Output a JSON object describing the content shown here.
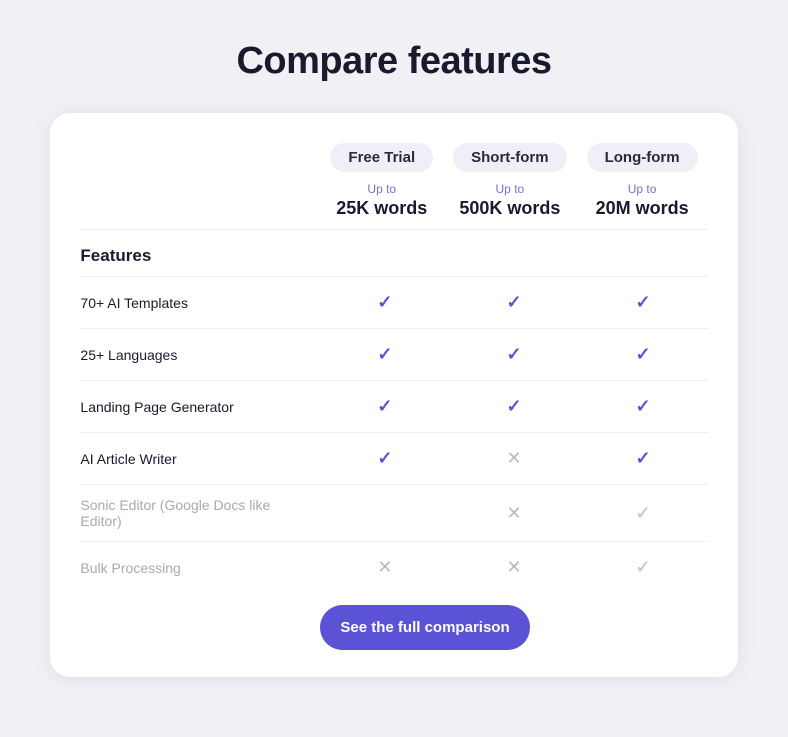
{
  "page": {
    "title": "Compare features"
  },
  "plans": [
    {
      "name": "Free Trial",
      "words_label": "Up to",
      "words_value": "25K words"
    },
    {
      "name": "Short-form",
      "words_label": "Up to",
      "words_value": "500K words"
    },
    {
      "name": "Long-form",
      "words_label": "Up to",
      "words_value": "20M words"
    }
  ],
  "features_label": "Features",
  "features": [
    {
      "name": "70+ AI Templates",
      "muted": false,
      "cols": [
        "check",
        "check",
        "check"
      ]
    },
    {
      "name": "25+ Languages",
      "muted": false,
      "cols": [
        "check",
        "check",
        "check"
      ]
    },
    {
      "name": "Landing Page Generator",
      "muted": false,
      "cols": [
        "check",
        "check",
        "check"
      ]
    },
    {
      "name": "AI Article Writer",
      "muted": false,
      "cols": [
        "check",
        "cross",
        "check"
      ]
    },
    {
      "name": "Sonic Editor (Google Docs like Editor)",
      "muted": true,
      "cols": [
        "none",
        "cross",
        "check_muted"
      ]
    },
    {
      "name": "Bulk Processing",
      "muted": true,
      "cols": [
        "cross",
        "cross",
        "check_muted"
      ]
    }
  ],
  "cta_button": {
    "label": "See the full comparison"
  }
}
